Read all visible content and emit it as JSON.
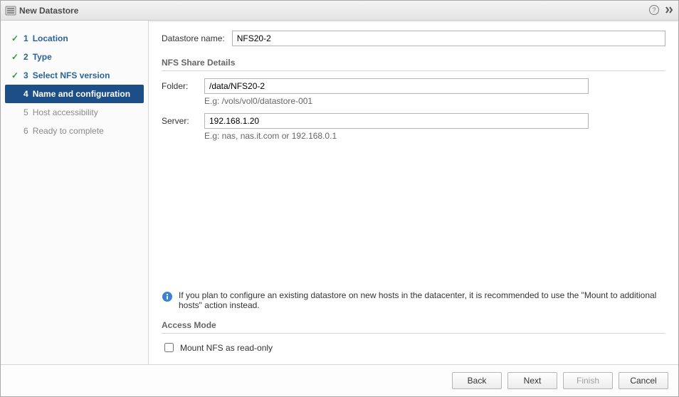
{
  "window_title": "New Datastore",
  "steps": [
    {
      "num": "1",
      "label": "Location",
      "state": "done"
    },
    {
      "num": "2",
      "label": "Type",
      "state": "done"
    },
    {
      "num": "3",
      "label": "Select NFS version",
      "state": "done"
    },
    {
      "num": "4",
      "label": "Name and configuration",
      "state": "active"
    },
    {
      "num": "5",
      "label": "Host accessibility",
      "state": "pending"
    },
    {
      "num": "6",
      "label": "Ready to complete",
      "state": "pending"
    }
  ],
  "datastore_name_label": "Datastore name:",
  "datastore_name_value": "NFS20-2",
  "nfs_section_title": "NFS Share Details",
  "folder_label": "Folder:",
  "folder_value": "/data/NFS20-2",
  "folder_hint": "E.g: /vols/vol0/datastore-001",
  "server_label": "Server:",
  "server_value": "192.168.1.20",
  "server_hint": "E.g: nas, nas.it.com or 192.168.0.1",
  "info_text": "If you plan to configure an existing datastore on new hosts in the datacenter, it is recommended to use the \"Mount to additional hosts\" action instead.",
  "access_mode_title": "Access Mode",
  "readonly_label": "Mount NFS as read-only",
  "readonly_checked": false,
  "footer": {
    "back": "Back",
    "next": "Next",
    "finish": "Finish",
    "cancel": "Cancel"
  }
}
